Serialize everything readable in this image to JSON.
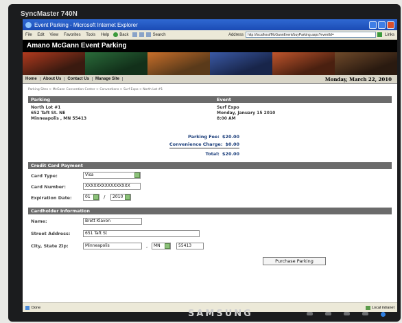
{
  "monitor": {
    "model": "SyncMaster 740N",
    "brand": "SAMSUNG"
  },
  "browser": {
    "title": "Event Parking - Microsoft Internet Explorer",
    "menus": [
      "File",
      "Edit",
      "View",
      "Favorites",
      "Tools",
      "Help"
    ],
    "back_label": "Back",
    "search_label": "Search",
    "address_label": "Address",
    "address_value": "http://localhost/McGannEvent/buyParking.aspx?eventId=",
    "links_label": "Links",
    "status_text": "Done",
    "zone_text": "Local intranet"
  },
  "site": {
    "title_prefix": "Amano McGann",
    "title_suffix": "Event Parking",
    "nav": [
      "Home",
      "About Us",
      "Contact Us",
      "Manage Site"
    ],
    "date": "Monday, March 22, 2010",
    "banner_colors": [
      "#b23a1e",
      "#2a6b3a",
      "#c96f2a",
      "#3b5aa6",
      "#c0552c",
      "#6f4a2a"
    ]
  },
  "breadcrumb": "Parking Sites > McGann Convention Center > Conventions > Surf Expo > North Lot #1",
  "parking": {
    "heading": "Parking",
    "event_heading": "Event",
    "lot_name": "North Lot #1",
    "street": "652 Taft St. NE",
    "city_line": "Minneapolis , MN 55413",
    "event_name": "Surf Expo",
    "event_date": "Monday, January 15 2010",
    "event_time": "8:00 AM",
    "parking_fee_label": "Parking Fee:",
    "parking_fee": "$20.00",
    "convenience_label": "Convenience Charge:",
    "convenience_fee": "$0.00",
    "total_label": "Total:",
    "total": "$20.00"
  },
  "payment": {
    "heading": "Credit Card Payment",
    "card_type_label": "Card Type:",
    "card_type": "Visa",
    "card_number_label": "Card Number:",
    "card_number": "XXXXXXXXXXXXXXXX",
    "expiration_label": "Expiration Date:",
    "exp_month": "01",
    "exp_year": "2010"
  },
  "cardholder": {
    "heading": "Cardholder Information",
    "name_label": "Name:",
    "name": "Brett Klavon",
    "street_label": "Street Address:",
    "street": "651 Taft St",
    "city_label": "City, State Zip:",
    "city": "Minneapolis",
    "state": "MN",
    "zip": "55413"
  },
  "purchase_button": "Purchase Parking"
}
